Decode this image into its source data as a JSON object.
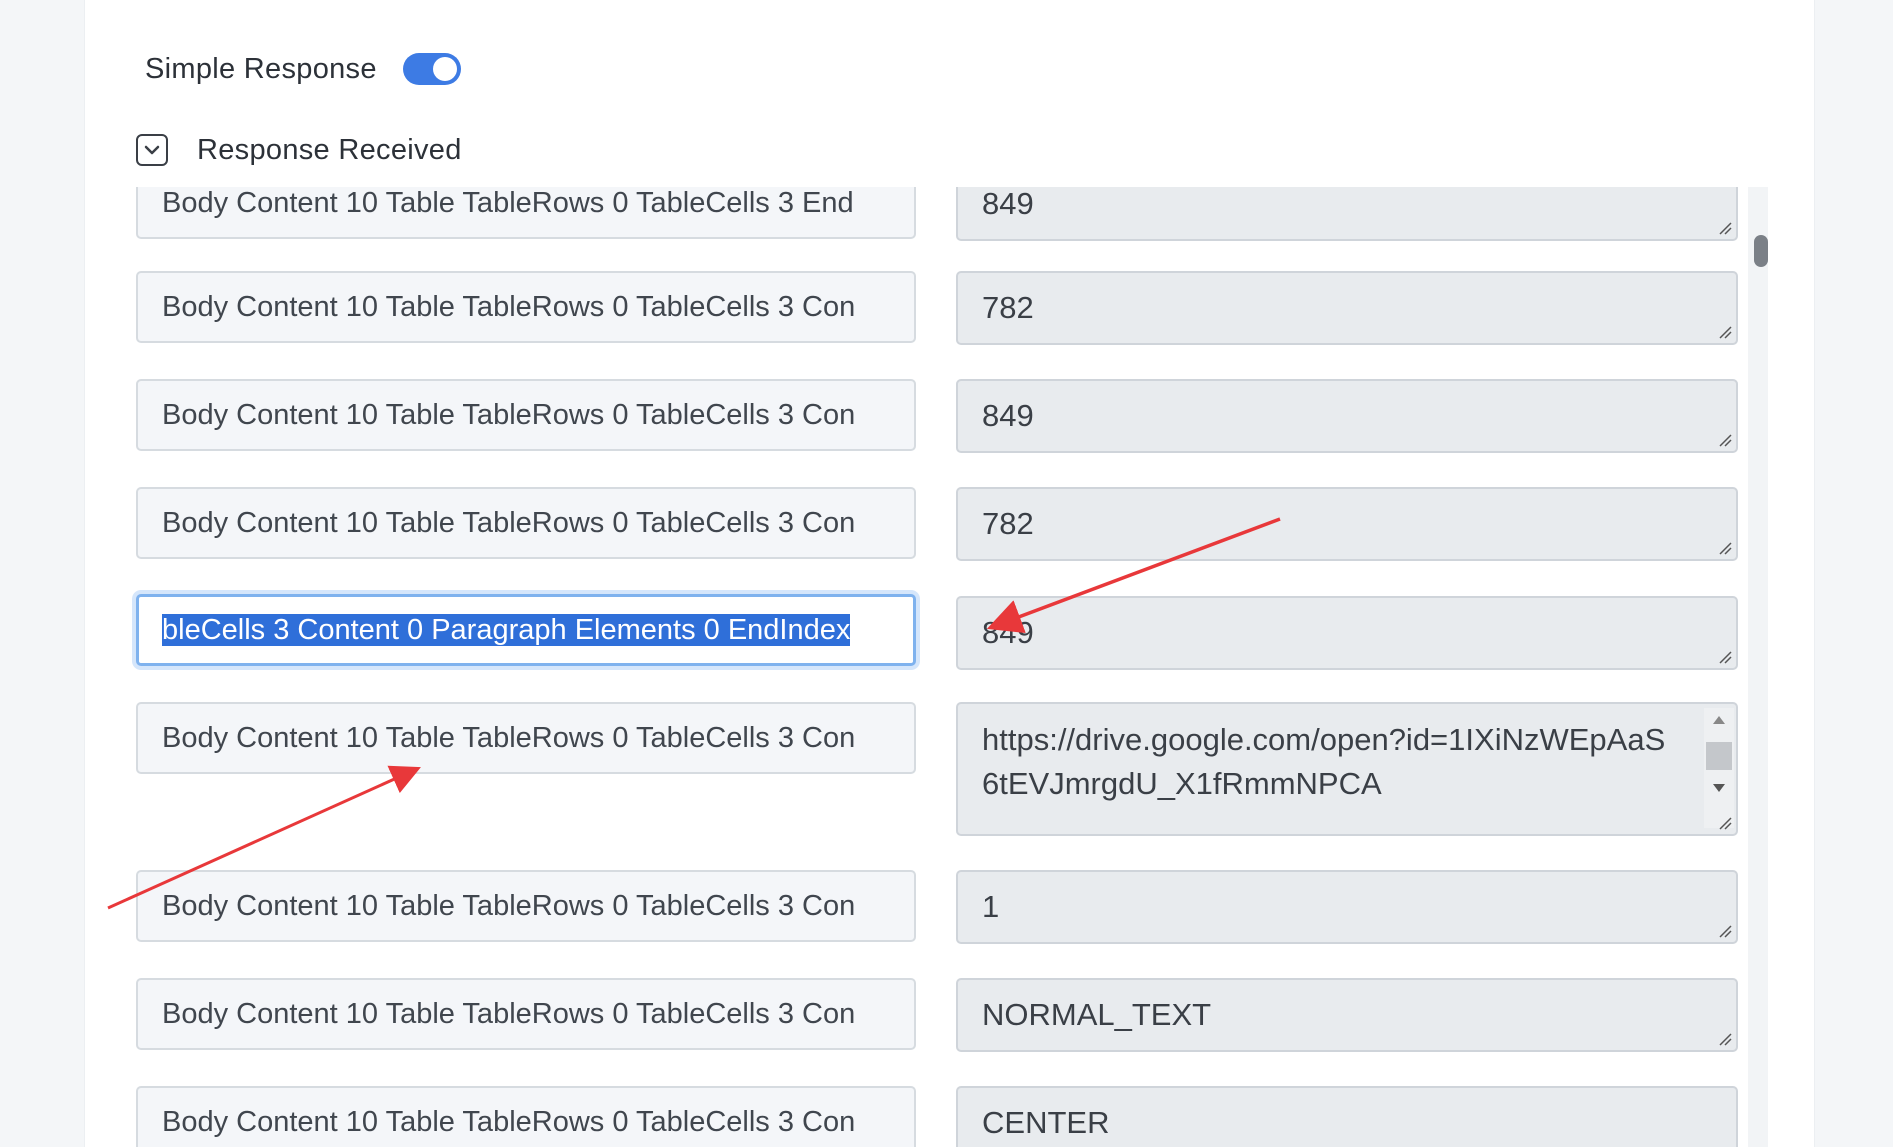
{
  "simple_response": {
    "label": "Simple Response",
    "enabled": true
  },
  "accordion": {
    "label": "Response Received",
    "icon": "chevron-down-icon"
  },
  "rows": [
    {
      "key": "Body Content 10 Table TableRows 0 TableCells 3 End",
      "value": "849"
    },
    {
      "key": "Body Content 10 Table TableRows 0 TableCells 3 Con",
      "value": "782"
    },
    {
      "key": "Body Content 10 Table TableRows 0 TableCells 3 Con",
      "value": "849"
    },
    {
      "key": "Body Content 10 Table TableRows 0 TableCells 3 Con",
      "value": "782"
    },
    {
      "key": "bleCells 3 Content 0 Paragraph Elements 0 EndIndex",
      "value": "849"
    },
    {
      "key": "Body Content 10 Table TableRows 0 TableCells 3 Con",
      "value": "https://drive.google.com/open?id=1IXiNzWEpAaS6tEVJmrgdU_X1fRmmNPCA"
    },
    {
      "key": "Body Content 10 Table TableRows 0 TableCells 3 Con",
      "value": "1"
    },
    {
      "key": "Body Content 10 Table TableRows 0 TableCells 3 Con",
      "value": "NORMAL_TEXT"
    },
    {
      "key": "Body Content 10 Table TableRows 0 TableCells 3 Con",
      "value": "CENTER"
    }
  ],
  "colors": {
    "toggle_on": "#3d7be4",
    "selection": "#2f6fd9",
    "annotation_arrow": "#e8383a"
  }
}
